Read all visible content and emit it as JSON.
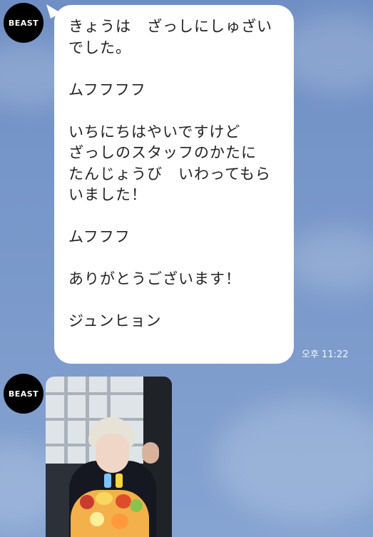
{
  "chat": {
    "sender_avatar_text": "BEAST",
    "message_lines": [
      "きょうは　ざっしにしゅざい",
      "でした。",
      "",
      "ムフフフフ",
      "",
      "いちにちはやいですけど",
      "ざっしのスタッフのかたに",
      "たんじょうび　いわってもら",
      "いました！",
      "",
      "ムフフフ",
      "",
      "ありがとうございます！",
      "",
      "ジュンヒョン"
    ],
    "timestamp": "오후 11:22"
  },
  "colors": {
    "bubble_background": "#ffffff",
    "chat_background": "#7a97c8",
    "avatar_background": "#000000"
  },
  "icons": {
    "message_tail": "bubble-tail-icon"
  }
}
